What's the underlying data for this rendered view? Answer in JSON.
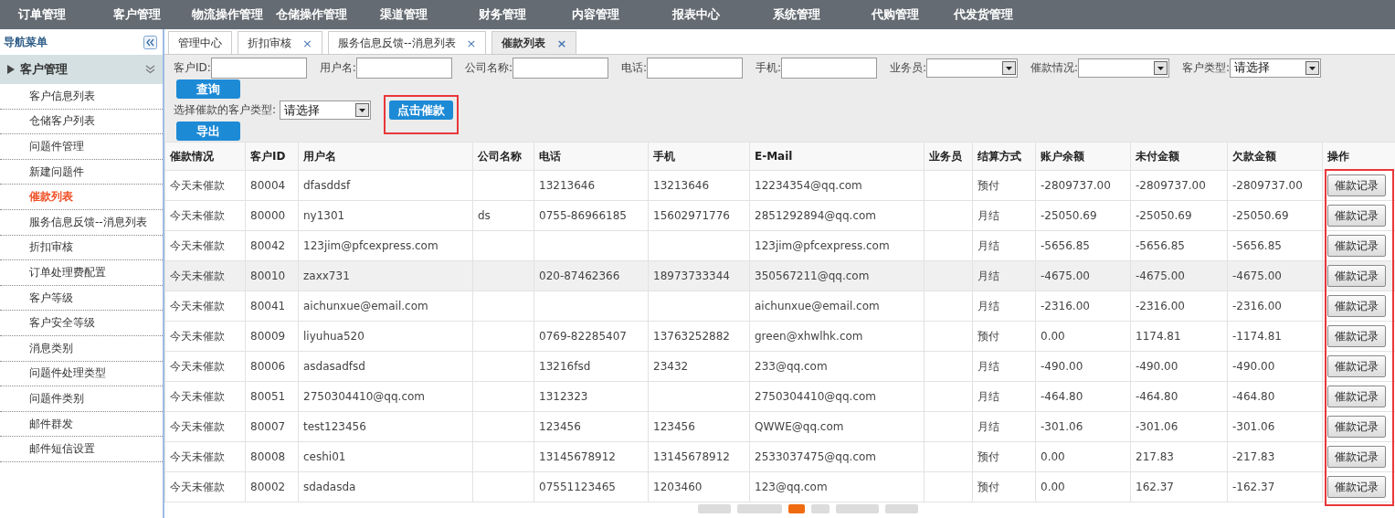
{
  "top_menu": [
    "订单管理",
    "客户管理",
    "物流操作管理",
    "仓储操作管理",
    "渠道管理",
    "财务管理",
    "内容管理",
    "报表中心",
    "系统管理",
    "代购管理",
    "代发货管理"
  ],
  "sidebar": {
    "title": "导航菜单",
    "section": {
      "label": "客户管理",
      "expanded": true,
      "items": [
        {
          "label": "客户信息列表",
          "selected": false
        },
        {
          "label": "仓储客户列表",
          "selected": false
        },
        {
          "label": "问题件管理",
          "selected": false
        },
        {
          "label": "新建问题件",
          "selected": false
        },
        {
          "label": "催款列表",
          "selected": true
        },
        {
          "label": "服务信息反馈--消息列表",
          "selected": false
        },
        {
          "label": "折扣审核",
          "selected": false
        },
        {
          "label": "订单处理费配置",
          "selected": false
        },
        {
          "label": "客户等级",
          "selected": false
        },
        {
          "label": "客户安全等级",
          "selected": false
        },
        {
          "label": "消息类别",
          "selected": false
        },
        {
          "label": "问题件处理类型",
          "selected": false
        },
        {
          "label": "问题件类别",
          "selected": false
        },
        {
          "label": "邮件群发",
          "selected": false
        },
        {
          "label": "邮件短信设置",
          "selected": false
        }
      ]
    }
  },
  "tabs": [
    {
      "label": "管理中心",
      "selected": false
    },
    {
      "label": "折扣审核",
      "close": "×",
      "selected": false
    },
    {
      "label": "服务信息反馈--消息列表",
      "close": "×",
      "selected": false
    },
    {
      "label": "催款列表",
      "close": "×",
      "selected": true
    }
  ],
  "filters": [
    {
      "kind": "input",
      "label": "客户ID:"
    },
    {
      "kind": "input",
      "label": "用户名:"
    },
    {
      "kind": "input",
      "label": "公司名称:"
    },
    {
      "kind": "input",
      "label": "电话:"
    },
    {
      "kind": "input",
      "label": "手机:"
    },
    {
      "kind": "select",
      "label": "业务员:"
    },
    {
      "kind": "select",
      "label": "催款情况:"
    },
    {
      "kind": "select",
      "label": "客户类型:",
      "value": "请选择"
    }
  ],
  "query_button": "查询",
  "urge_type": {
    "label": "选择催款的客户类型:",
    "value": "请选择"
  },
  "urge_button": {
    "label": "点击催款",
    "highlighted": true
  },
  "export_button": "导出",
  "table": {
    "columns": [
      "催款情况",
      "客户ID",
      "用户名",
      "公司名称",
      "电话",
      "手机",
      "E-Mail",
      "业务员",
      "结算方式",
      "账户余额",
      "未付金额",
      "欠款金额",
      "操作"
    ],
    "action_column_highlighted": true,
    "rows": [
      {
        "hovered": false,
        "cells": [
          "今天未催款",
          "80004",
          "dfasddsf",
          "",
          "13213646",
          "13213646",
          "12234354@qq.com",
          "",
          "预付",
          "-2809737.00",
          "-2809737.00",
          "-2809737.00"
        ],
        "action": "催款记录"
      },
      {
        "hovered": false,
        "cells": [
          "今天未催款",
          "80000",
          "ny1301",
          "ds",
          "0755-86966185",
          "15602971776",
          "2851292894@qq.com",
          "",
          "月结",
          "-25050.69",
          "-25050.69",
          "-25050.69"
        ],
        "action": "催款记录"
      },
      {
        "hovered": false,
        "cells": [
          "今天未催款",
          "80042",
          "123jim@pfcexpress.com",
          "",
          "",
          "",
          "123jim@pfcexpress.com",
          "",
          "月结",
          "-5656.85",
          "-5656.85",
          "-5656.85"
        ],
        "action": "催款记录"
      },
      {
        "hovered": true,
        "cells": [
          "今天未催款",
          "80010",
          "zaxx731",
          "",
          "020-87462366",
          "18973733344",
          "350567211@qq.com",
          "",
          "月结",
          "-4675.00",
          "-4675.00",
          "-4675.00"
        ],
        "action": "催款记录"
      },
      {
        "hovered": false,
        "cells": [
          "今天未催款",
          "80041",
          "aichunxue@email.com",
          "",
          "",
          "",
          "aichunxue@email.com",
          "",
          "月结",
          "-2316.00",
          "-2316.00",
          "-2316.00"
        ],
        "action": "催款记录"
      },
      {
        "hovered": false,
        "cells": [
          "今天未催款",
          "80009",
          "liyuhua520",
          "",
          "0769-82285407",
          "13763252882",
          "green@xhwlhk.com",
          "",
          "预付",
          "0.00",
          "1174.81",
          "-1174.81"
        ],
        "action": "催款记录"
      },
      {
        "hovered": false,
        "cells": [
          "今天未催款",
          "80006",
          "asdasadfsd",
          "",
          "13216fsd",
          "23432",
          "233@qq.com",
          "",
          "月结",
          "-490.00",
          "-490.00",
          "-490.00"
        ],
        "action": "催款记录"
      },
      {
        "hovered": false,
        "cells": [
          "今天未催款",
          "80051",
          "2750304410@qq.com",
          "",
          "1312323",
          "",
          "2750304410@qq.com",
          "",
          "月结",
          "-464.80",
          "-464.80",
          "-464.80"
        ],
        "action": "催款记录"
      },
      {
        "hovered": false,
        "cells": [
          "今天未催款",
          "80007",
          "test123456",
          "",
          "123456",
          "123456",
          "QWWE@qq.com",
          "",
          "月结",
          "-301.06",
          "-301.06",
          "-301.06"
        ],
        "action": "催款记录"
      },
      {
        "hovered": false,
        "cells": [
          "今天未催款",
          "80008",
          "ceshi01",
          "",
          "13145678912",
          "13145678912",
          "2533037475@qq.com",
          "",
          "预付",
          "0.00",
          "217.83",
          "-217.83"
        ],
        "action": "催款记录"
      },
      {
        "hovered": false,
        "cells": [
          "今天未催款",
          "80002",
          "sdadasda",
          "",
          "07551123465",
          "1203460",
          "123@qq.com",
          "",
          "预付",
          "0.00",
          "162.37",
          "-162.37"
        ],
        "action": "催款记录"
      }
    ]
  },
  "pagination": [
    {
      "selected": false
    },
    {
      "selected": false
    },
    {
      "selected": true
    },
    {
      "selected": false
    },
    {
      "selected": false
    },
    {
      "selected": false
    }
  ]
}
